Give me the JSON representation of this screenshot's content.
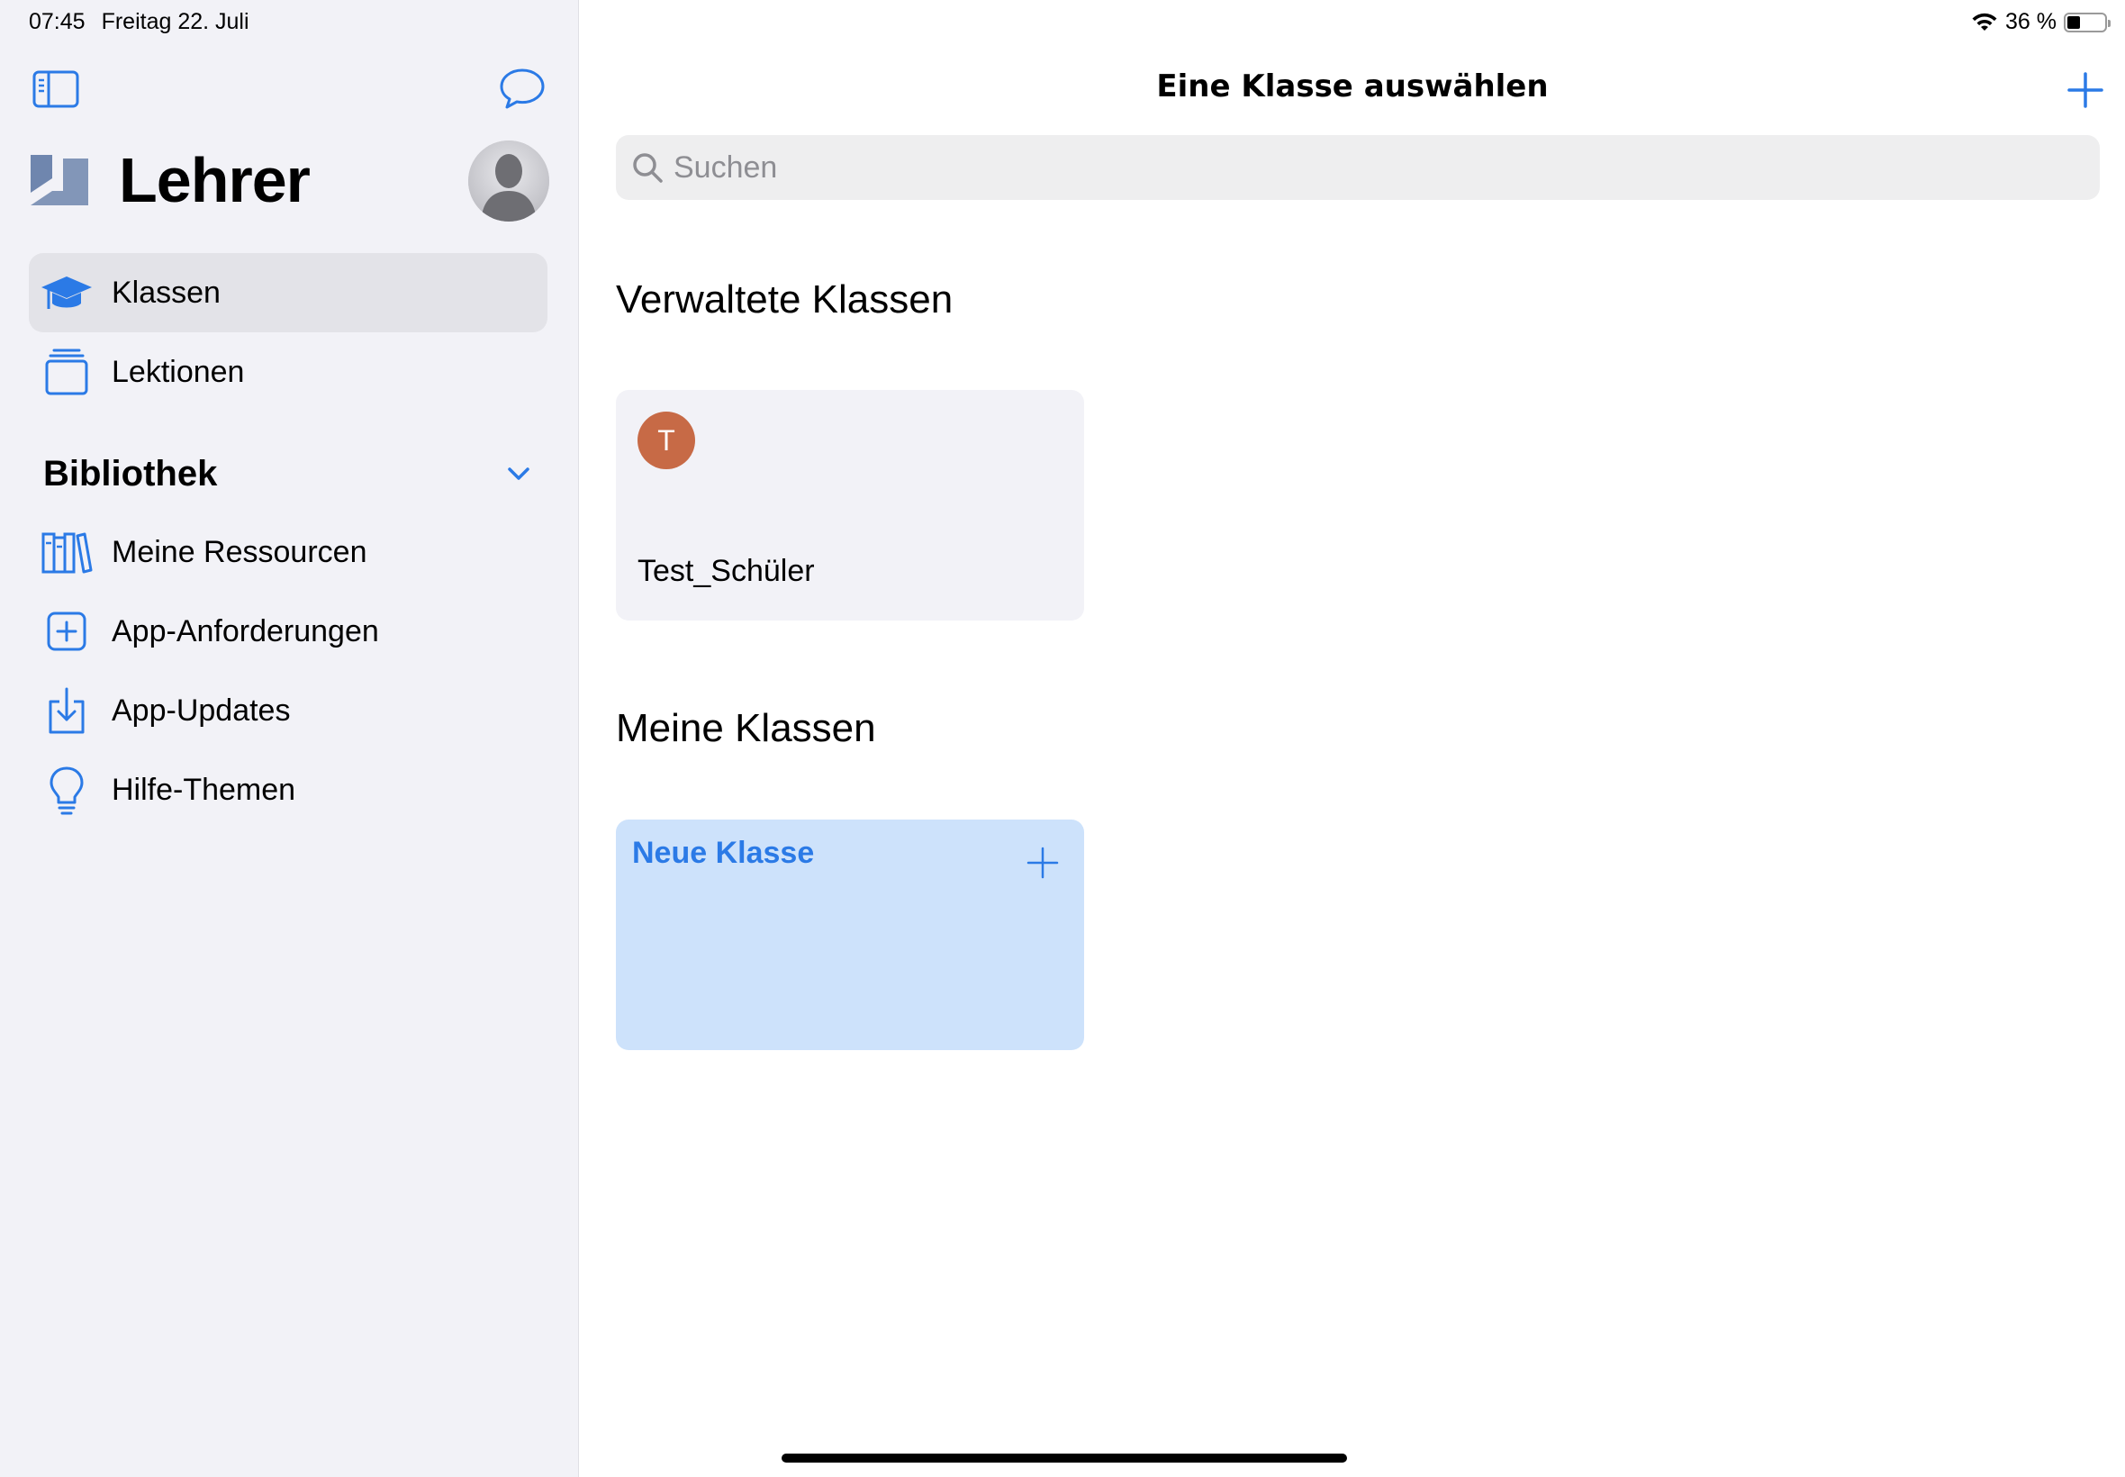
{
  "status_bar": {
    "time": "07:45",
    "date": "Freitag 22. Juli",
    "battery": "36 %",
    "battery_level": 0.36
  },
  "sidebar": {
    "app_title": "Lehrer",
    "toggle_icon": "sidebar-icon",
    "chat_icon": "chat-bubble-icon",
    "items": [
      {
        "label": "Klassen",
        "icon": "graduation-cap-icon",
        "selected": true
      },
      {
        "label": "Lektionen",
        "icon": "stack-icon",
        "selected": false
      }
    ],
    "library": {
      "title": "Bibliothek",
      "items": [
        {
          "label": "Meine Ressourcen",
          "icon": "books-icon"
        },
        {
          "label": "App-Anforderungen",
          "icon": "plus-square-icon"
        },
        {
          "label": "App-Updates",
          "icon": "download-icon"
        },
        {
          "label": "Hilfe-Themen",
          "icon": "lightbulb-icon"
        }
      ]
    }
  },
  "main": {
    "title": "Eine Klasse auswählen",
    "search": {
      "placeholder": "Suchen",
      "value": ""
    },
    "managed": {
      "title": "Verwaltete Klassen",
      "classes": [
        {
          "initial": "T",
          "name": "Test_Schüler",
          "color": "#c76a46"
        }
      ]
    },
    "mine": {
      "title": "Meine Klassen",
      "new_class_label": "Neue Klasse"
    }
  },
  "colors": {
    "accent": "#2b7ae6",
    "sidebar_bg": "#f2f2f7",
    "selected_bg": "#e3e3e8",
    "new_card_bg": "#cde2fb"
  }
}
